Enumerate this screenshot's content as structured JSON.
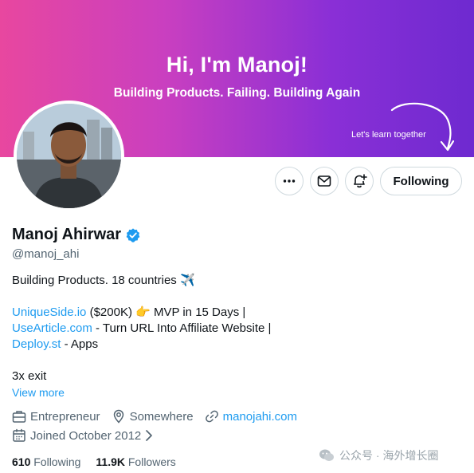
{
  "banner": {
    "title": "Hi, I'm Manoj!",
    "subtitle": "Building Products. Failing. Building Again",
    "note": "Let's learn together"
  },
  "actions": {
    "more_icon": "more-dots-icon",
    "message_icon": "envelope-icon",
    "notify_icon": "bell-plus-icon",
    "follow_label": "Following"
  },
  "profile": {
    "name": "Manoj Ahirwar",
    "handle": "@manoj_ahi",
    "verified": true
  },
  "bio": {
    "line1": "Building Products. 18 countries ✈️",
    "line2_link": "UniqueSide.io",
    "line2_rest": " ($200K) 👉 MVP in 15 Days |",
    "line3_link": "UseArticle.com",
    "line3_rest": " - Turn URL Into Affiliate Website |",
    "line4_link": "Deploy.st",
    "line4_rest": " - Apps",
    "line5": "3x exit",
    "view_more": "View more"
  },
  "meta": {
    "category": "Entrepreneur",
    "location": "Somewhere",
    "website": "manojahi.com",
    "joined": "Joined October 2012"
  },
  "stats": {
    "following_count": "610",
    "following_label": "Following",
    "followers_count": "11.9K",
    "followers_label": "Followers"
  },
  "watermark": {
    "text": "公众号 · 海外增长圈"
  },
  "colors": {
    "accent": "#1d9bf0",
    "muted": "#536471",
    "banner_start": "#e8479f",
    "banner_end": "#6e2ad0"
  }
}
